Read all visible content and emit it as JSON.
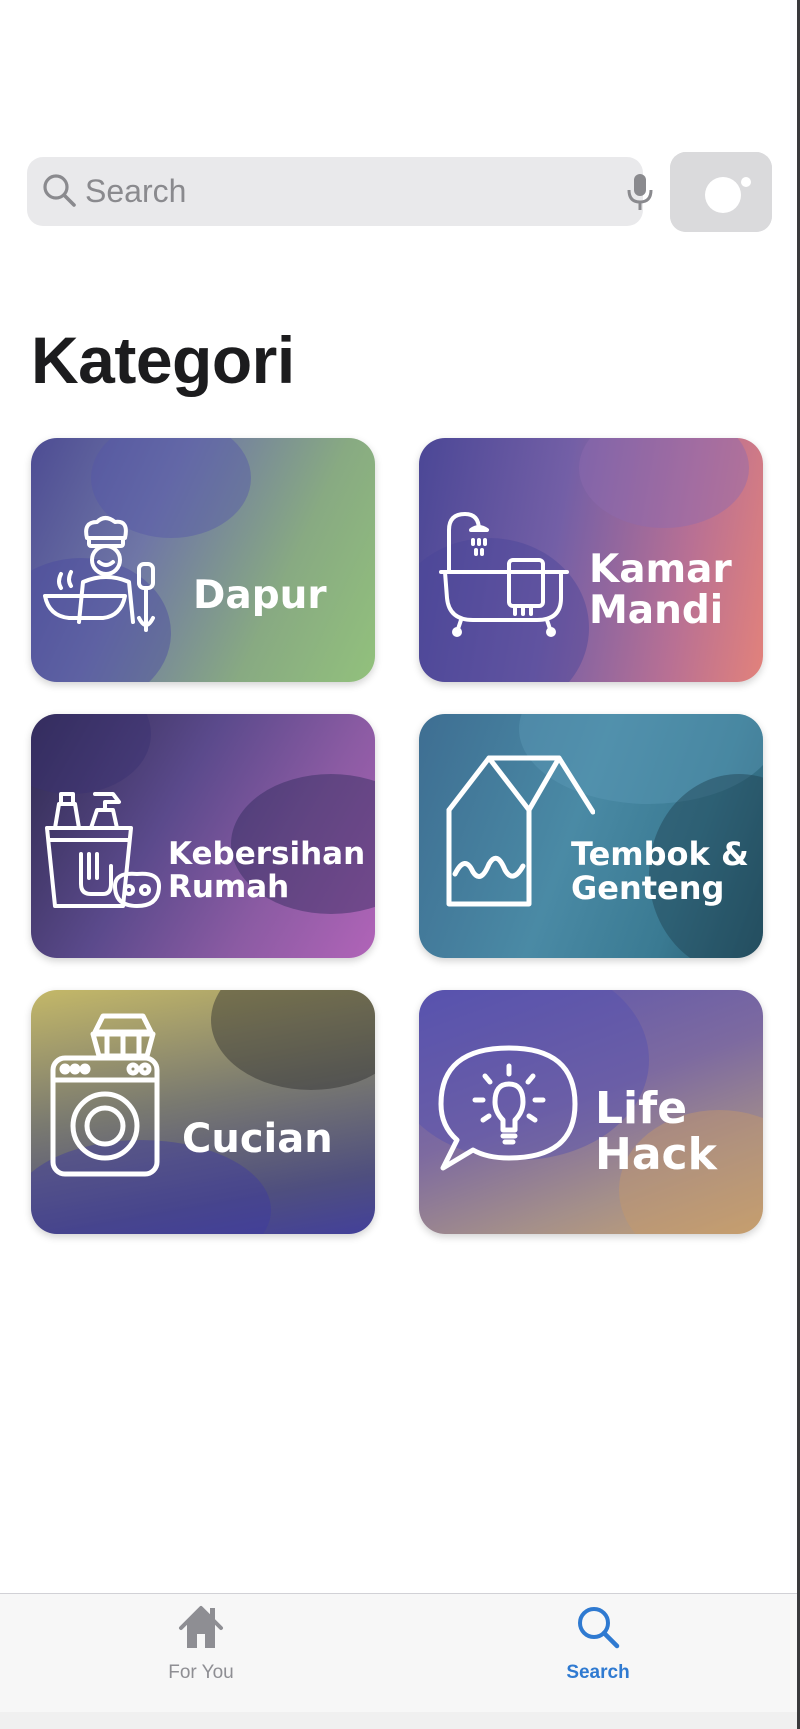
{
  "search": {
    "placeholder": "Search",
    "icon": "search-icon",
    "mic_icon": "microphone-icon"
  },
  "camera": {
    "icon": "camera-icon"
  },
  "section": {
    "title": "Kategori"
  },
  "categories": [
    {
      "label": "Dapur",
      "icon": "chef-icon"
    },
    {
      "label": "Kamar\nMandi",
      "icon": "bathtub-icon"
    },
    {
      "label": "Kebersihan\nRumah",
      "icon": "cleaning-supplies-icon"
    },
    {
      "label": "Tembok &\nGenteng",
      "icon": "house-wall-icon"
    },
    {
      "label": "Cucian",
      "icon": "washing-machine-icon"
    },
    {
      "label": "Life\nHack",
      "icon": "lightbulb-idea-icon"
    }
  ],
  "tabbar": {
    "tabs": [
      {
        "label": "For You",
        "icon": "home-icon",
        "active": false
      },
      {
        "label": "Search",
        "icon": "search-icon",
        "active": true
      }
    ],
    "active_color": "#2f7ad1",
    "inactive_color": "#8e8e93"
  }
}
